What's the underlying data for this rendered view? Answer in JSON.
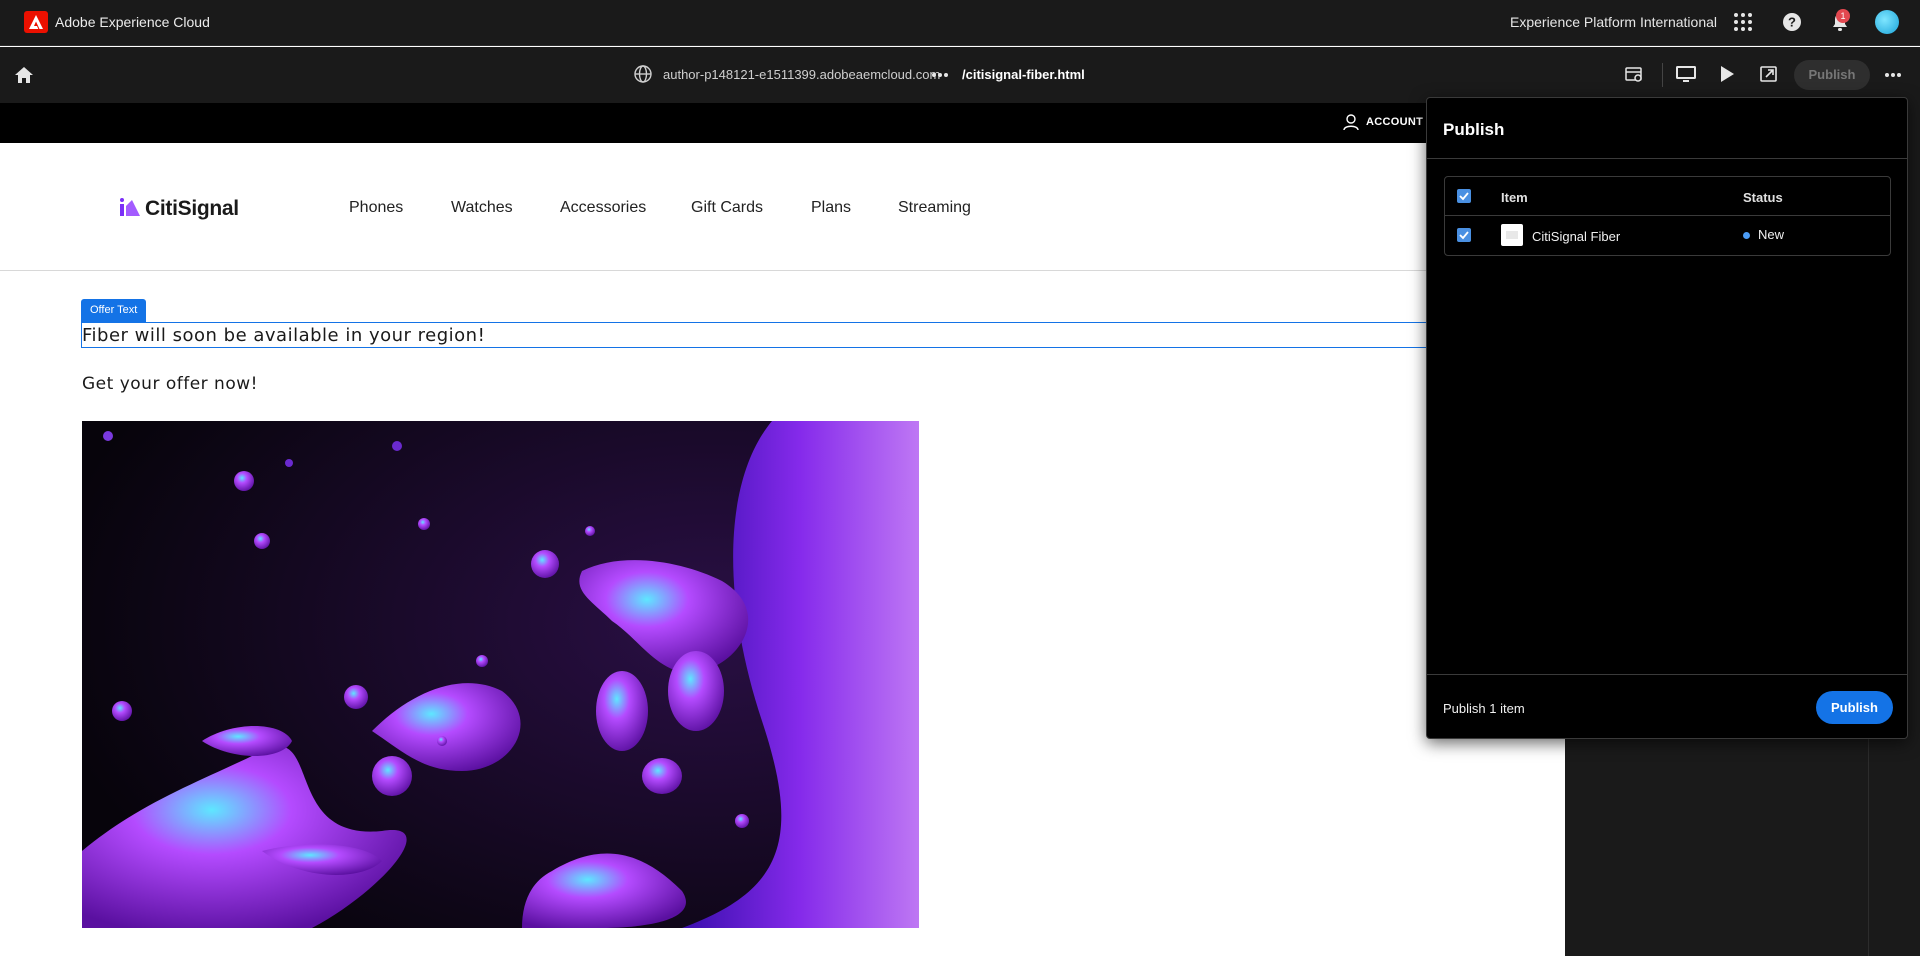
{
  "shell": {
    "brand": "Adobe Experience Cloud",
    "org": "Experience Platform International",
    "notification_count": "1",
    "icons": [
      "apps-grid-icon",
      "help-icon",
      "bell-icon",
      "avatar"
    ]
  },
  "toolbar": {
    "host": "author-p148121-e1511399.adobeaemcloud.com",
    "path": "/citisignal-fiber.html",
    "publish_label": "Publish",
    "icons": [
      "home-icon",
      "globe-icon",
      "more-dots-icon",
      "properties-icon",
      "desktop-icon",
      "preview-play-icon",
      "open-page-icon",
      "more-dots-icon"
    ]
  },
  "site": {
    "account_label": "ACCOUNT",
    "logo_text": "CitiSignal",
    "nav": [
      "Phones",
      "Watches",
      "Accessories",
      "Gift Cards",
      "Plans",
      "Streaming"
    ]
  },
  "content": {
    "offer_tag": "Offer Text",
    "offer_text": "Fiber will soon be available in your region!",
    "cta_text": "Get your offer now!"
  },
  "publish_panel": {
    "title": "Publish",
    "columns": [
      "Item",
      "Status"
    ],
    "rows": [
      {
        "name": "CitiSignal Fiber",
        "status": "New",
        "checked": true
      }
    ],
    "footer_text": "Publish 1 item",
    "publish_label": "Publish"
  },
  "colors": {
    "accent": "#1473e6",
    "shell_bg": "#1a1a1a",
    "adobe_red": "#eb1000",
    "status_new": "#4b9cf5"
  }
}
